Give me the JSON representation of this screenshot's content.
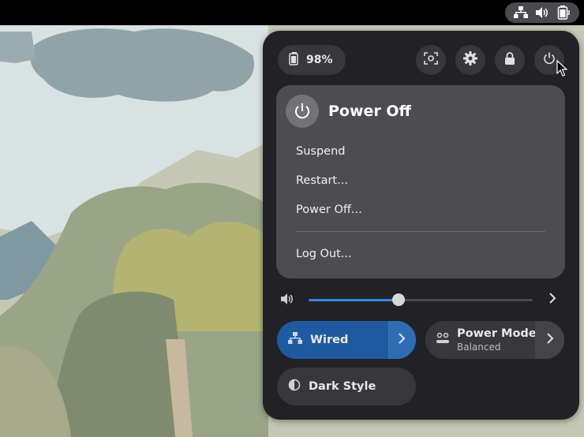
{
  "topbar": {
    "icons": [
      "network-wired-icon",
      "volume-icon",
      "battery-icon"
    ]
  },
  "quick_settings": {
    "battery_label": "98%",
    "buttons": [
      "screenshot-icon",
      "settings-icon",
      "lock-icon",
      "power-icon"
    ]
  },
  "power_menu": {
    "title": "Power Off",
    "items": [
      "Suspend",
      "Restart...",
      "Power Off...",
      "Log Out..."
    ]
  },
  "volume": {
    "level": 0.4
  },
  "toggles": {
    "wired": {
      "label": "Wired",
      "active": true
    },
    "power_mode": {
      "label": "Power Mode",
      "subtitle": "Balanced"
    },
    "dark_style": {
      "label": "Dark Style"
    }
  },
  "colors": {
    "accent": "#3584e4",
    "active_toggle": "#1f5aa0",
    "panel_bg": "#222226",
    "submenu_bg": "#4d4d51"
  }
}
